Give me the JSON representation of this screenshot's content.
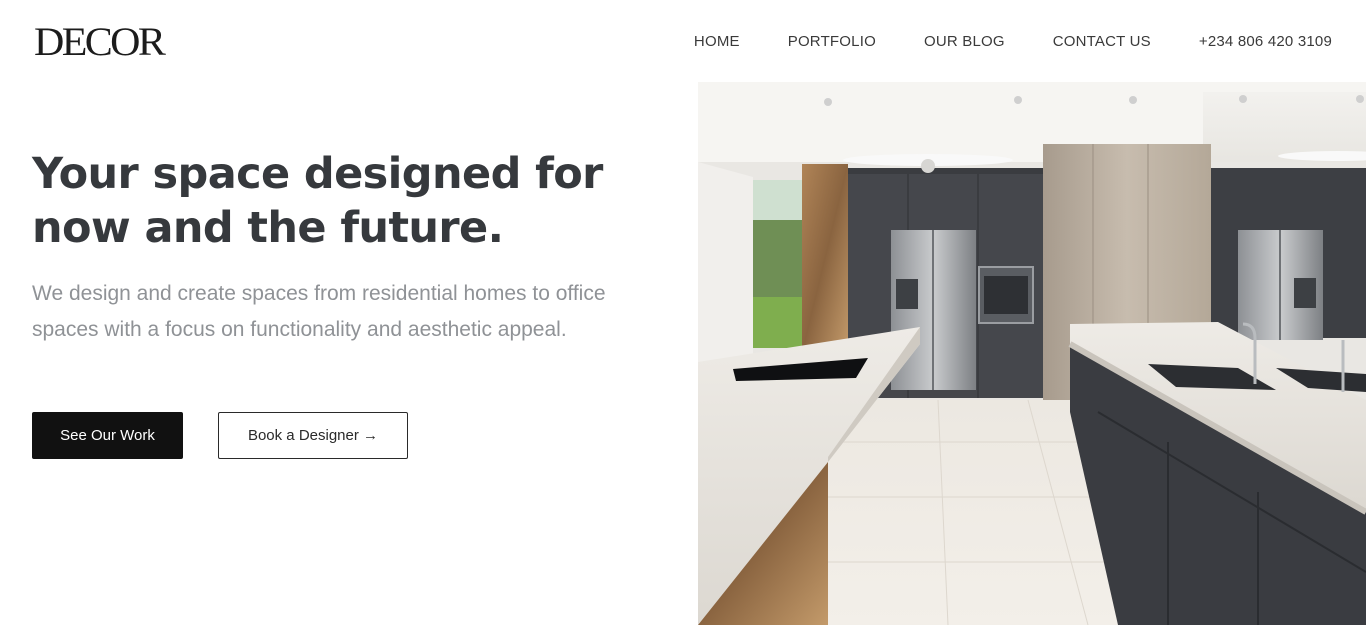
{
  "brand": {
    "logo_text": "DECOR"
  },
  "nav": {
    "items": [
      "HOME",
      "PORTFOLIO",
      "OUR BLOG",
      "CONTACT US"
    ],
    "phone": "+234 806 420 3109"
  },
  "hero": {
    "title": "Your space designed for now and the future.",
    "description": "We design and create spaces from residential homes to office spaces with a focus on functionality and aesthetic appeal.",
    "primary_button": "See Our Work",
    "secondary_button": "Book a Designer →"
  },
  "colors": {
    "primary_button_bg": "#111111",
    "title_text": "#36393d",
    "body_text": "#8f9296"
  }
}
